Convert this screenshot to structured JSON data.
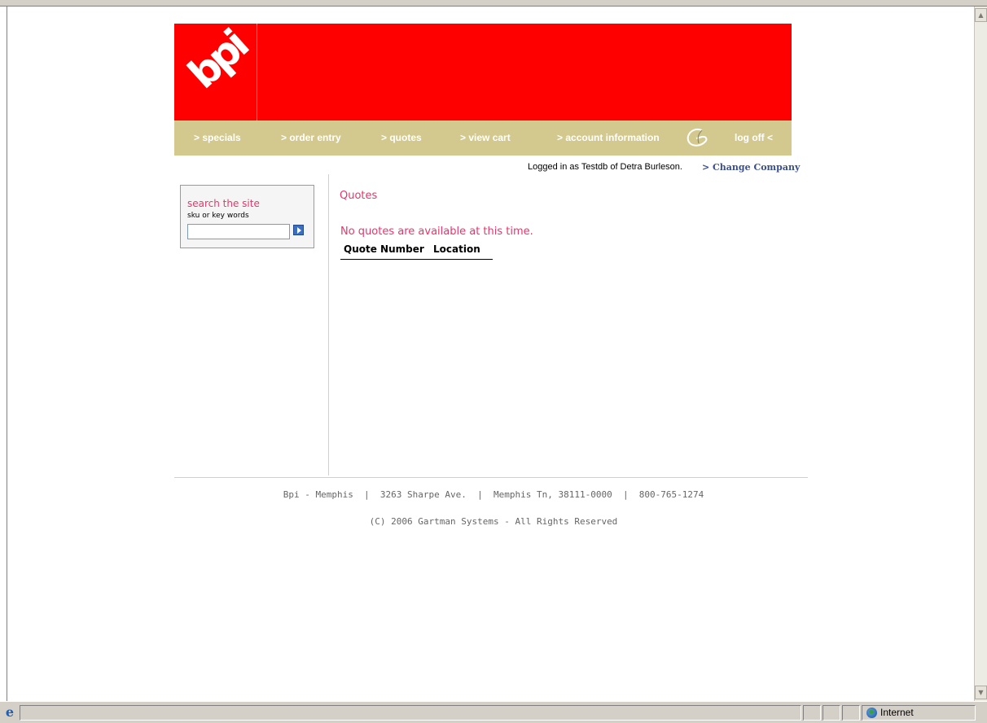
{
  "header": {
    "logo_text": "bpi",
    "brand_color": "#ff0000",
    "nav_color": "#d3c98f"
  },
  "nav": {
    "specials": "> specials",
    "order_entry": "> order entry",
    "quotes": "> quotes",
    "view_cart": "> view cart",
    "account_information": "> account information",
    "log_off": "log off <"
  },
  "session": {
    "logged_in": "Logged in as Testdb of Detra Burleson.",
    "change_company": "> Change Company"
  },
  "search": {
    "title": "search the site",
    "subtitle": "sku or key words",
    "value": "",
    "button_icon": "arrow-right-icon"
  },
  "main": {
    "title": "Quotes",
    "message": "No quotes are available at this time.",
    "columns": [
      "Quote Number",
      "Location"
    ]
  },
  "footer": {
    "address": "Bpi - Memphis  |  3263 Sharpe Ave.  |  Memphis Tn, 38111-0000  |  800-765-1274",
    "copyright": "(C) 2006 Gartman Systems - All Rights Reserved"
  },
  "statusbar": {
    "zone": "Internet",
    "zone_icon": "globe-icon",
    "browser_icon": "ie-icon"
  },
  "accent_color": "#e8356a",
  "link_color": "#3a4e8c"
}
